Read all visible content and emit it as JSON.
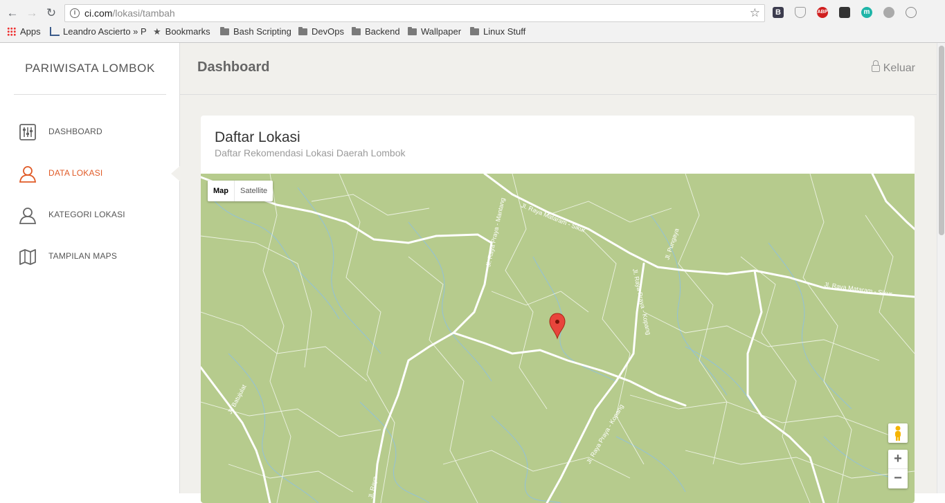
{
  "browser": {
    "url_host": "ci.com",
    "url_path": "/lokasi/tambah",
    "bookmarks": [
      {
        "label": "Apps",
        "icon": "apps-grid-icon"
      },
      {
        "label": "Leandro Ascierto » P",
        "icon": "site-favicon-icon"
      },
      {
        "label": "Bookmarks",
        "icon": "star-icon"
      },
      {
        "label": "Bash Scripting",
        "icon": "folder-icon"
      },
      {
        "label": "DevOps",
        "icon": "folder-icon"
      },
      {
        "label": "Backend",
        "icon": "folder-icon"
      },
      {
        "label": "Wallpaper",
        "icon": "folder-icon"
      },
      {
        "label": "Linux Stuff",
        "icon": "folder-icon"
      }
    ],
    "extensions": [
      {
        "label": "B",
        "color": "#3c3c4e"
      },
      {
        "label": "ABP",
        "color": "#d01f1f"
      },
      {
        "label": "m",
        "color": "#1fb5a8"
      }
    ]
  },
  "sidebar": {
    "brand": "PARIWISATA LOMBOK",
    "items": [
      {
        "label": "DASHBOARD",
        "icon": "sliders-icon",
        "active": false
      },
      {
        "label": "DATA LOKASI",
        "icon": "user-icon",
        "active": true
      },
      {
        "label": "KATEGORI LOKASI",
        "icon": "user-icon",
        "active": false
      },
      {
        "label": "TAMPILAN MAPS",
        "icon": "map-icon",
        "active": false
      }
    ],
    "active_color": "#e05a26"
  },
  "header": {
    "title": "Dashboard",
    "logout_label": "Keluar"
  },
  "card": {
    "title": "Daftar Lokasi",
    "subtitle": "Daftar Rekomendasi Lokasi Daerah Lombok"
  },
  "map": {
    "type_options": [
      "Map",
      "Satellite"
    ],
    "selected_type": "Map",
    "road_labels": [
      "Jl. Raya Praya - Mantang",
      "Jl. Raya Mataram - Sikur",
      "Jl. Pungaya",
      "Jl. Raya Praya - Kopang",
      "Jl. Raya Mataram - Sikur",
      "Jl. Raya Praya - Kopang",
      "Jl. Batujulat",
      "Jl. Raya"
    ],
    "zoom_in_label": "+",
    "zoom_out_label": "−",
    "land_color": "#b6cb8d",
    "marker_color": "#e8453c"
  }
}
